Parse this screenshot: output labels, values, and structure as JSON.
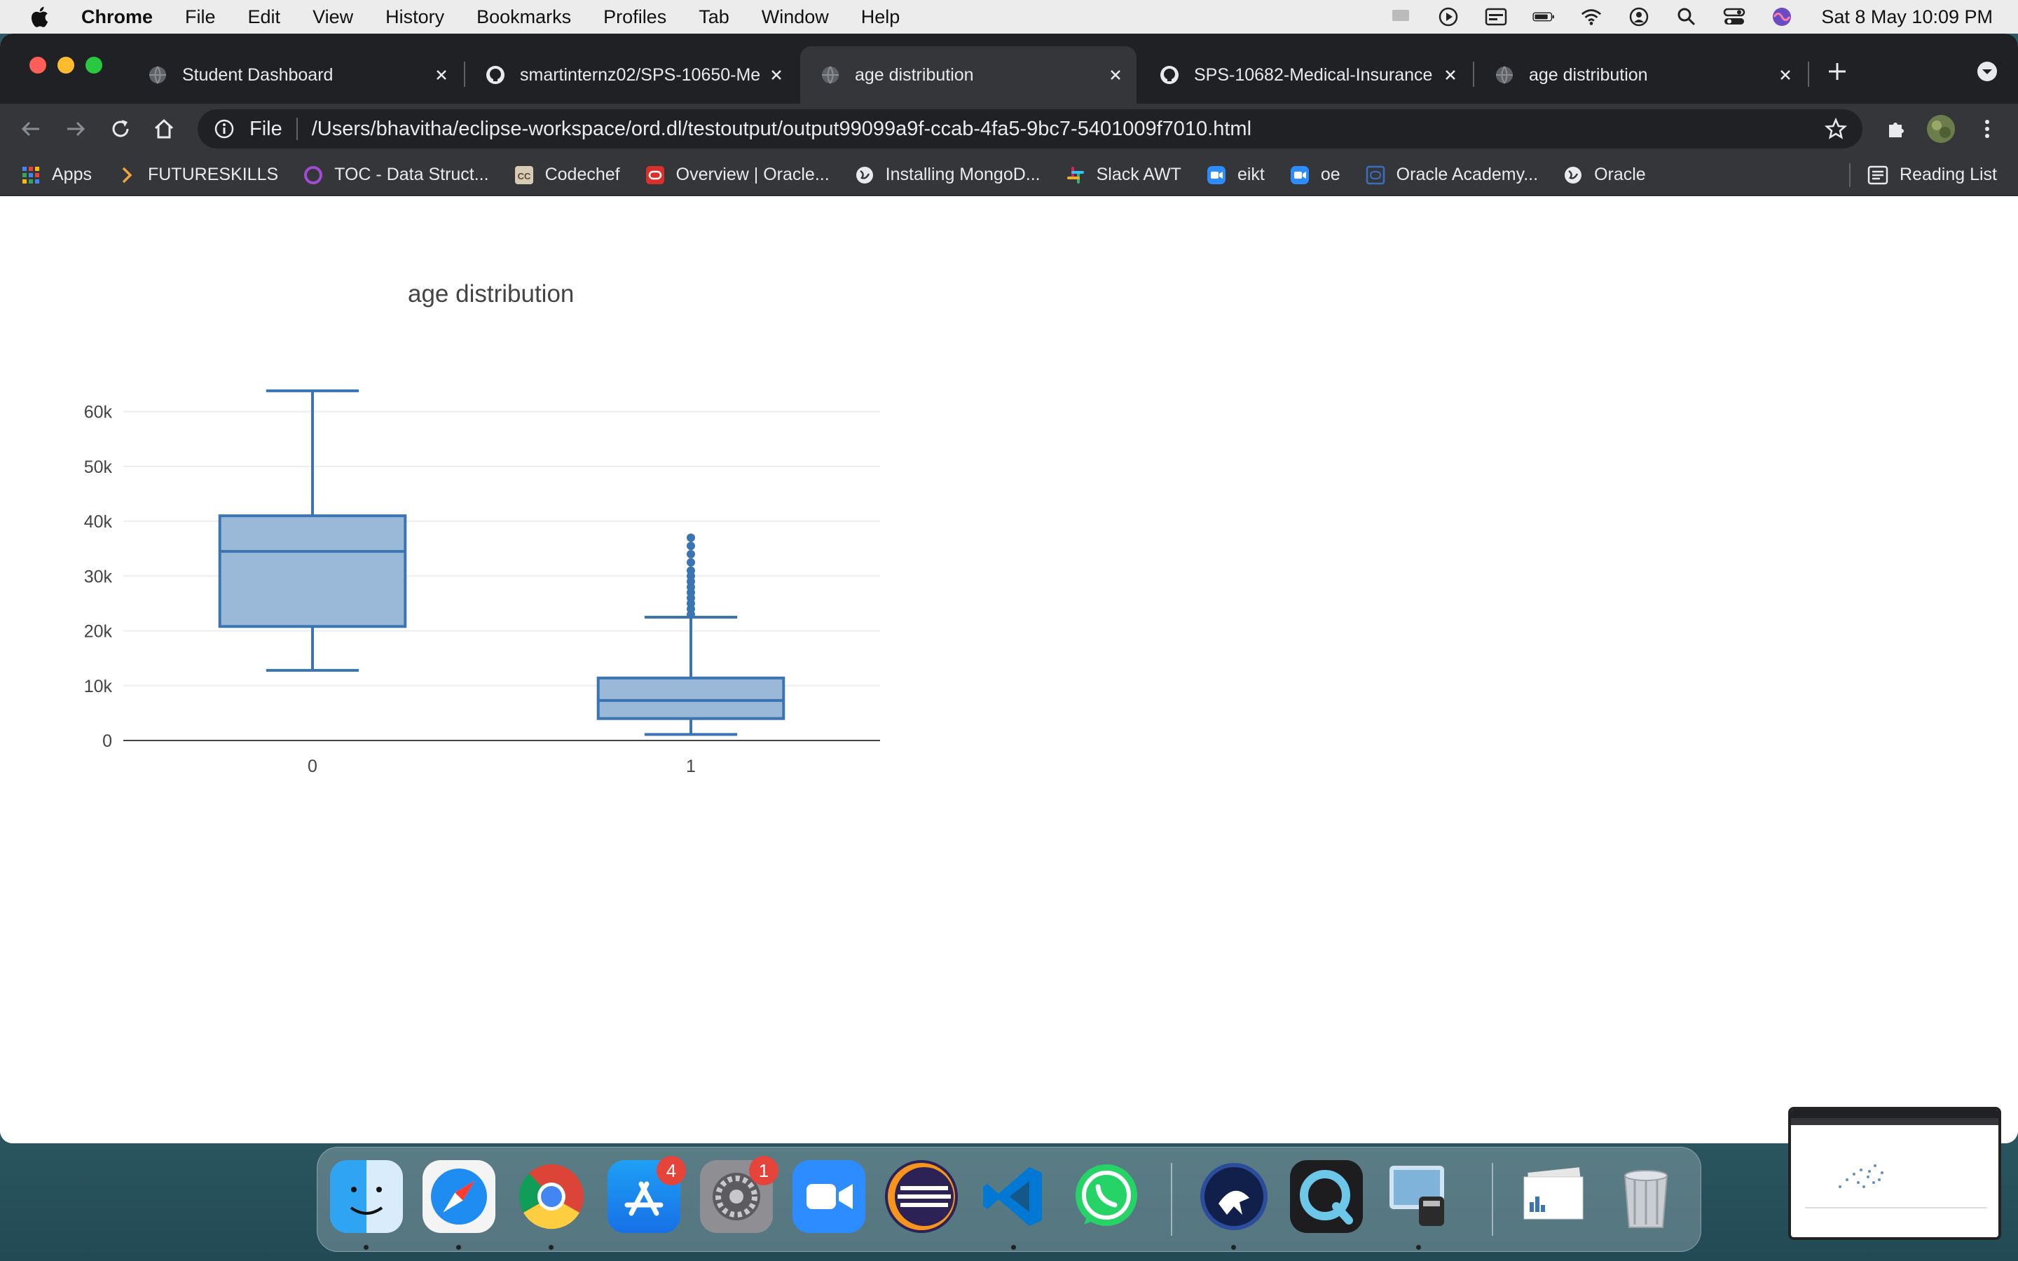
{
  "menubar": {
    "app": "Chrome",
    "items": [
      "File",
      "Edit",
      "View",
      "History",
      "Bookmarks",
      "Profiles",
      "Tab",
      "Window",
      "Help"
    ],
    "clock": "Sat 8 May  10:09 PM"
  },
  "tabs": [
    {
      "title": "Student Dashboard",
      "icon": "globe-icon",
      "active": false
    },
    {
      "title": "smartinternz02/SPS-10650-Me",
      "icon": "github-icon",
      "active": false
    },
    {
      "title": "age distribution",
      "icon": "globe-icon",
      "active": true
    },
    {
      "title": "SPS-10682-Medical-Insurance",
      "icon": "github-icon",
      "active": false
    },
    {
      "title": "age distribution",
      "icon": "globe-icon",
      "active": false
    }
  ],
  "omnibox": {
    "scheme": "File",
    "url": "/Users/bhavitha/eclipse-workspace/ord.dl/testoutput/output99099a9f-ccab-4fa5-9bc7-5401009f7010.html"
  },
  "bookmarks": {
    "items": [
      "Apps",
      "FUTURESKILLS",
      "TOC - Data Struct...",
      "Codechef",
      "Overview | Oracle...",
      "Installing MongoD...",
      "Slack AWT",
      "eikt",
      "oe",
      "Oracle Academy...",
      "Oracle"
    ],
    "reading_list": "Reading List"
  },
  "dock": {
    "apps": [
      "Finder",
      "Safari",
      "Chrome",
      "App Store",
      "System Preferences",
      "Zoom",
      "Eclipse",
      "Visual Studio Code",
      "WhatsApp",
      "Cyberduck",
      "QuickTime",
      "Preview",
      "Documents",
      "Trash"
    ],
    "badges": {
      "app_store": "4",
      "system_preferences": "1"
    }
  },
  "chart_data": {
    "type": "box",
    "title": "age distribution",
    "xlabel": "",
    "ylabel": "",
    "categories": [
      "0",
      "1"
    ],
    "boxes": [
      {
        "category": "0",
        "min": 12800,
        "q1": 20800,
        "median": 34500,
        "q3": 41000,
        "max": 63800,
        "outliers": []
      },
      {
        "category": "1",
        "min": 1100,
        "q1": 4000,
        "median": 7300,
        "q3": 11400,
        "max": 22500,
        "outliers": [
          23000,
          24000,
          25000,
          26000,
          27000,
          28000,
          29000,
          30000,
          31000,
          32500,
          34000,
          35500,
          37000
        ]
      }
    ],
    "yticks": [
      0,
      10000,
      20000,
      30000,
      40000,
      50000,
      60000
    ],
    "ytick_labels": [
      "0",
      "10k",
      "20k",
      "30k",
      "40k",
      "50k",
      "60k"
    ],
    "ylim": [
      0,
      68000
    ],
    "grid": true,
    "colors": {
      "box_line": "#3a75b2",
      "box_fill": "#9ab8d8"
    }
  }
}
